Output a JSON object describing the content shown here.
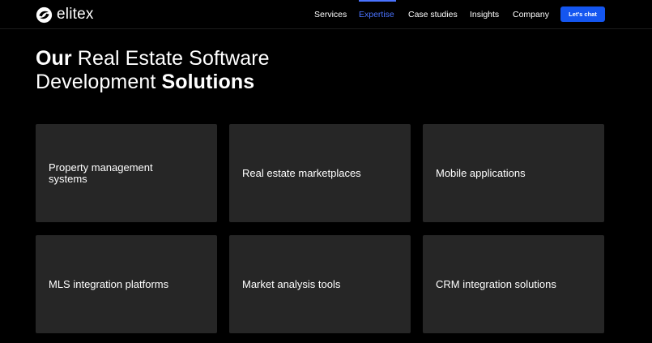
{
  "brand": {
    "name": "elitex",
    "logo_icon": "elitex-swirl-logo-icon"
  },
  "colors": {
    "background": "#000000",
    "card": "#262626",
    "accent": "#4a73ff",
    "cta": "#1456f0",
    "text": "#ffffff"
  },
  "nav": {
    "items": [
      {
        "label": "Services",
        "active": false
      },
      {
        "label": "Expertise",
        "active": true
      },
      {
        "label": "Case studies",
        "active": false
      },
      {
        "label": "Insights",
        "active": false
      },
      {
        "label": "Company",
        "active": false
      }
    ],
    "cta_label": "Let's chat"
  },
  "hero": {
    "title_line1_bold": "Our",
    "title_line1_rest": " Real Estate Software",
    "title_line2_rest": "Development ",
    "title_line2_bold": "Solutions"
  },
  "solutions": [
    {
      "title": "Property management systems"
    },
    {
      "title": "Real estate marketplaces"
    },
    {
      "title": "Mobile applications"
    },
    {
      "title": "MLS integration platforms"
    },
    {
      "title": "Market analysis tools"
    },
    {
      "title": "CRM integration solutions"
    }
  ]
}
